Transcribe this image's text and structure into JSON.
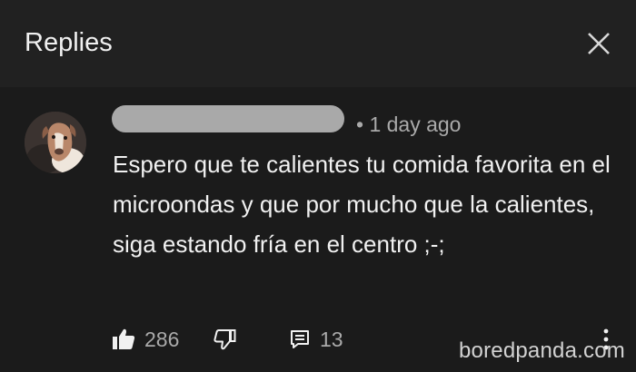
{
  "header": {
    "title": "Replies",
    "close_icon": "close-icon"
  },
  "comment": {
    "avatar_icon": "dog-avatar",
    "timestamp": "• 1 day ago",
    "text": "Espero que te calientes tu comida favorita en el microondas y que por mucho que la calientes, siga estando fría en el centro ;-;",
    "likes": "286",
    "replies": "13"
  },
  "watermark": "boredpanda.com",
  "colors": {
    "header_bg": "#212121",
    "body_bg": "#1b1b1b",
    "text": "#f1f1f1",
    "secondary_text": "#aaaaaa",
    "redacted_name": "#a9a9a9"
  }
}
